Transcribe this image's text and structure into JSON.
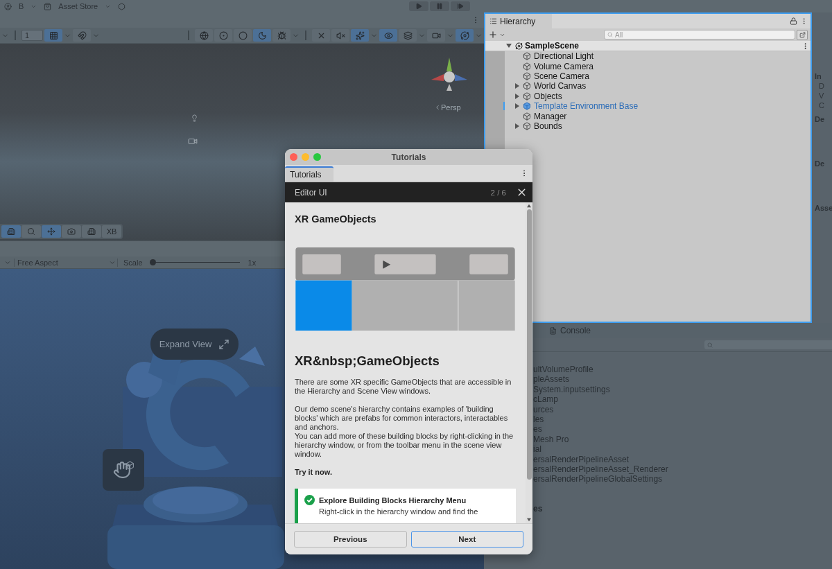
{
  "top_bar": {
    "account": "B",
    "store": "Asset Store",
    "controls": [
      {
        "kind": "play",
        "active": false
      },
      {
        "kind": "pause",
        "active": false
      },
      {
        "kind": "step",
        "active": false
      }
    ]
  },
  "scene_toolbar": {
    "grid_size": "1",
    "buttons": [
      {
        "kind": "grid",
        "active": true
      },
      {
        "kind": "snap",
        "active": false
      },
      {
        "kind": "wireframe",
        "active": false
      },
      {
        "kind": "shaded",
        "active": false
      },
      {
        "kind": "solid",
        "active": false
      },
      {
        "kind": "lit",
        "active": true
      },
      {
        "kind": "debug",
        "active": false
      },
      {
        "kind": "twod",
        "active": false
      },
      {
        "kind": "audio",
        "active": false
      },
      {
        "kind": "effects",
        "active": true
      },
      {
        "kind": "visibility",
        "active": true
      },
      {
        "kind": "layers",
        "active": false
      },
      {
        "kind": "camera",
        "active": false
      },
      {
        "kind": "gizmos",
        "active": true
      }
    ]
  },
  "scene_view": {
    "projection": "Persp"
  },
  "scene_tools": [
    {
      "kind": "building",
      "active": true
    },
    {
      "kind": "search",
      "active": false
    },
    {
      "kind": "move",
      "active": true
    },
    {
      "kind": "camera",
      "active": false
    },
    {
      "kind": "city",
      "active": false
    },
    {
      "kind": "text",
      "label": "XB",
      "active": false
    }
  ],
  "game_toolbar": {
    "aspect": "Free Aspect",
    "scale_label": "Scale",
    "scale": {
      "level": 0
    },
    "scale_reading": "1x"
  },
  "game_view": {
    "expand_button": "Expand View"
  },
  "hierarchy": {
    "tab": "Hierarchy",
    "search": {
      "placeholder": "All"
    },
    "scene": {
      "name": "SampleScene",
      "expanded": true,
      "children": [
        {
          "name": "Directional Light",
          "kind": "object",
          "expanded": false,
          "prefab": false
        },
        {
          "name": "Volume Camera",
          "kind": "object",
          "expanded": false,
          "prefab": false
        },
        {
          "name": "Scene Camera",
          "kind": "object",
          "expanded": false,
          "prefab": false
        },
        {
          "name": "World Canvas",
          "kind": "group",
          "expanded": false,
          "prefab": false
        },
        {
          "name": "Objects",
          "kind": "group",
          "expanded": false,
          "prefab": false
        },
        {
          "name": "Template Environment Base",
          "kind": "group",
          "expanded": false,
          "prefab": true
        },
        {
          "name": "Manager",
          "kind": "object",
          "expanded": false,
          "prefab": false
        },
        {
          "name": "Bounds",
          "kind": "group",
          "expanded": false,
          "prefab": false
        }
      ]
    }
  },
  "inspector": [
    {
      "text": "In",
      "kind": "header"
    },
    {
      "text": "D",
      "kind": "label"
    },
    {
      "text": "V",
      "kind": "label"
    },
    {
      "text": "C",
      "kind": "label"
    },
    {
      "text": "De",
      "kind": "header"
    },
    {
      "text": "De",
      "kind": "section"
    },
    {
      "text": "Asse",
      "kind": "section"
    }
  ],
  "console": {
    "tab": "Console",
    "items": [
      {
        "text": "ultVolumeProfile",
        "kind": "file"
      },
      {
        "text": "pleAssets",
        "kind": "file"
      },
      {
        "text": "System.inputsettings",
        "kind": "file"
      },
      {
        "text": "cLamp",
        "kind": "file"
      },
      {
        "text": "urces",
        "kind": "file"
      },
      {
        "text": "les",
        "kind": "file"
      },
      {
        "text": "es",
        "kind": "file"
      },
      {
        "text": "Mesh Pro",
        "kind": "file"
      },
      {
        "text": "ial",
        "kind": "file"
      },
      {
        "text": "ersalRenderPipelineAsset",
        "kind": "file"
      },
      {
        "text": "ersalRenderPipelineAsset_Renderer",
        "kind": "file"
      },
      {
        "text": "ersalRenderPipelineGlobalSettings",
        "kind": "file"
      },
      {
        "text": "es",
        "kind": "header"
      }
    ]
  },
  "tutorial": {
    "title": "Tutorials",
    "tab": {
      "label": "Tutorials",
      "selected": true
    },
    "section": "Editor UI",
    "progress": "2 / 6",
    "page_title": "XR GameObjects",
    "heading": "XR&nbsp;GameObjects",
    "paragraphs": [
      [
        "There are some XR specific GameObjects that are accessible in the Hierarchy and Scene View windows."
      ],
      [
        "Our demo scene's hierarchy contains examples of 'building blocks' which are prefabs for common interactors, interactables and anchors.",
        "You can add more of these building blocks by right-clicking in the hierarchy window, or from the toolbar menu in the scene view window."
      ]
    ],
    "call_to_action": "Try it now.",
    "task": {
      "title": "Explore Building Blocks Hierarchy Menu",
      "description": "Right-click in the hierarchy window and find the",
      "done": true
    },
    "buttons": [
      {
        "label": "Previous",
        "focused": false
      },
      {
        "label": "Next",
        "focused": true
      }
    ]
  }
}
